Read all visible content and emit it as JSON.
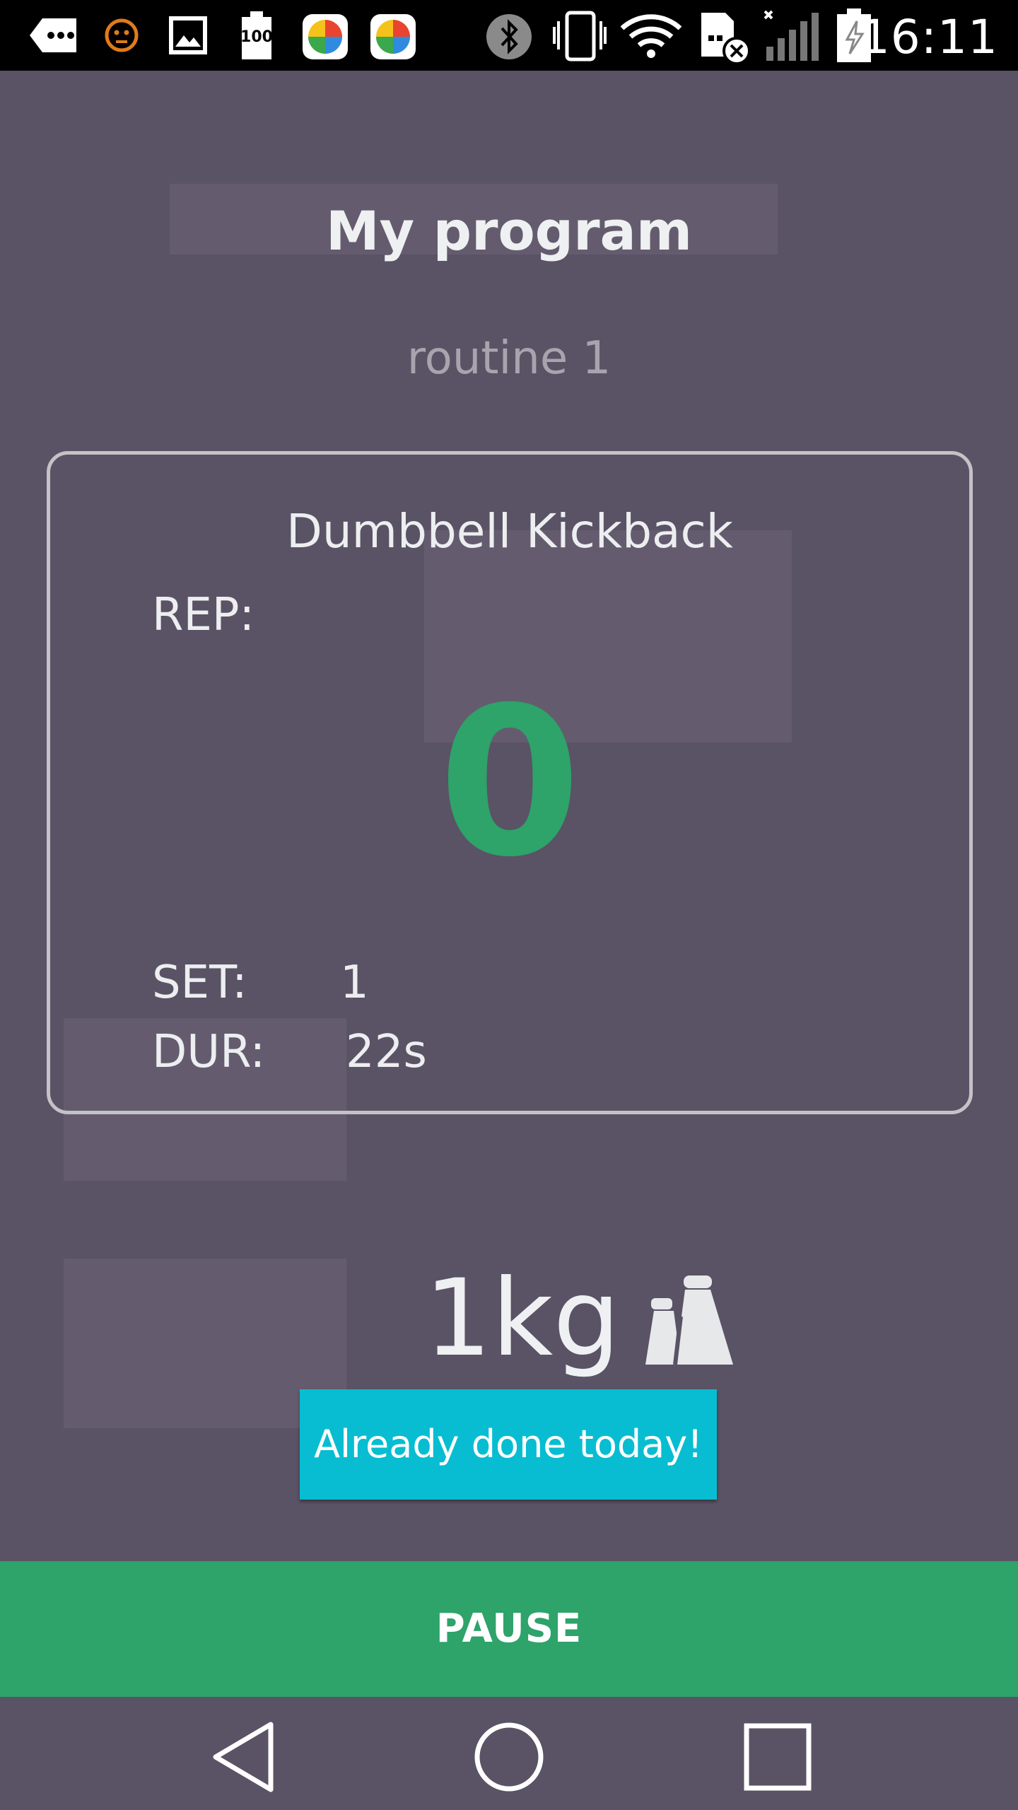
{
  "status_bar": {
    "time": "16:11",
    "icons": [
      "more-icon",
      "face-icon",
      "gallery-icon",
      "battery-100-icon",
      "app-ball-icon",
      "app-ball-icon",
      "bluetooth-icon",
      "vibrate-icon",
      "wifi-icon",
      "sim-error-icon",
      "signal-icon",
      "charging-battery-icon"
    ],
    "battery_badge": "100"
  },
  "header": {
    "title": "My program",
    "routine": "routine 1"
  },
  "exercise_card": {
    "name": "Dumbbell Kickback",
    "rep_label": "REP:",
    "rep_value": "0",
    "set_label": "SET:",
    "set_value": "1",
    "dur_label": "DUR:",
    "dur_value": "22s"
  },
  "weight": {
    "value": "1kg",
    "icon": "weights-icon"
  },
  "buttons": {
    "done_label": "Already done today!",
    "pause_label": "PAUSE"
  },
  "nav_bar": {
    "icons": [
      "back-icon",
      "home-icon",
      "recents-icon"
    ]
  },
  "colors": {
    "background": "#5a5265",
    "accent_green": "#2ea36a",
    "button_cyan": "#08bdd1"
  }
}
